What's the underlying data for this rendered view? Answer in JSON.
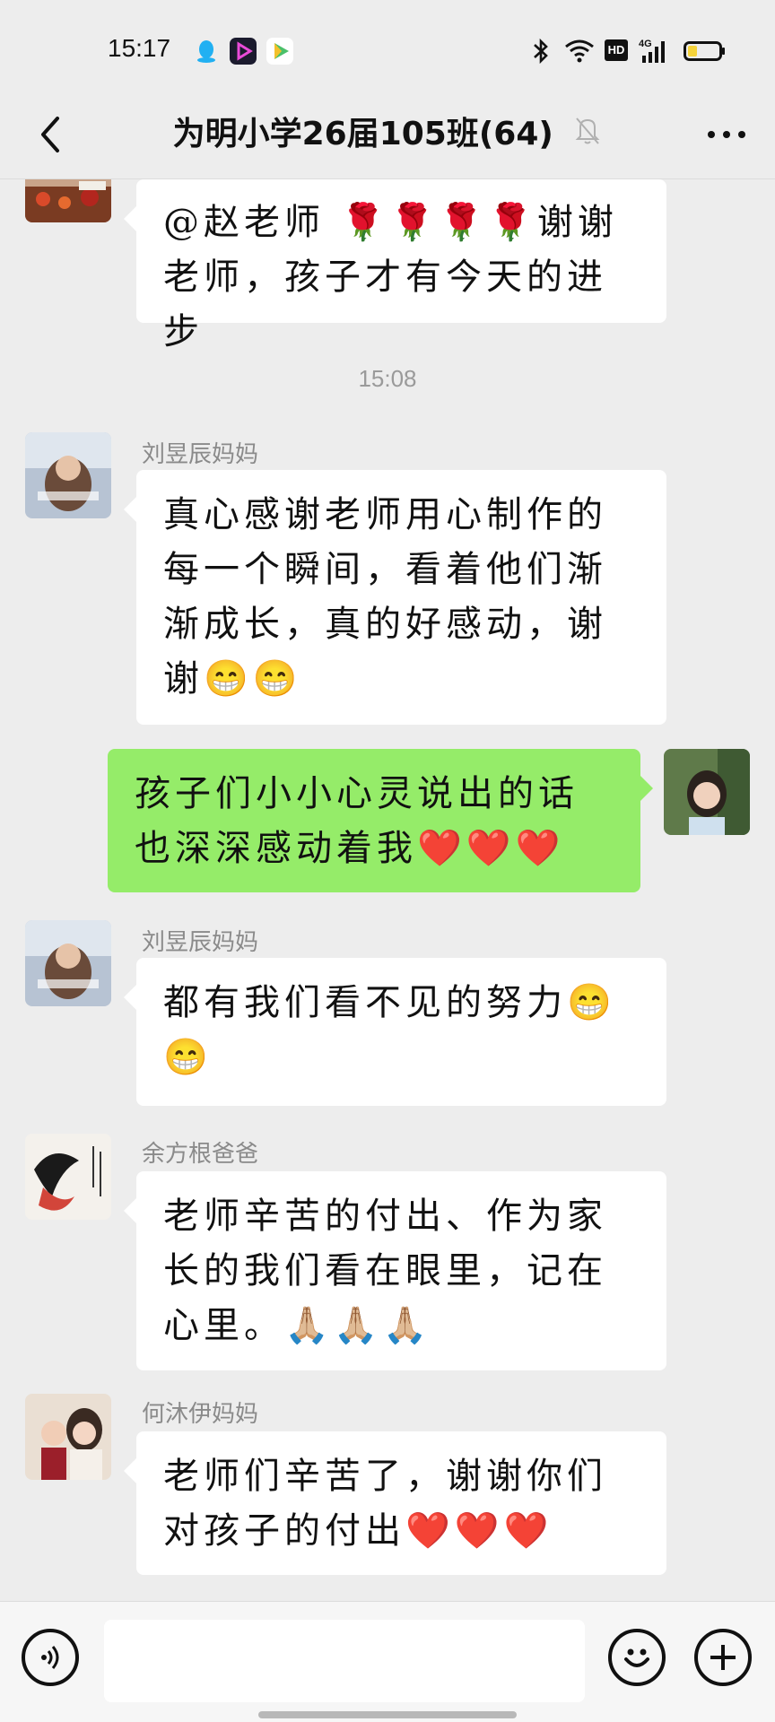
{
  "status_bar": {
    "time": "15:17",
    "icons": [
      "qq-icon",
      "video-app-icon",
      "media-play-icon"
    ],
    "right_icons": [
      "bluetooth-icon",
      "wifi-icon",
      "hd-icon",
      "4g-signal-icon",
      "battery-icon"
    ],
    "hd_label": "HD",
    "network_label": "4G"
  },
  "title_bar": {
    "title": "为明小学26届105班(64)",
    "muted": true
  },
  "messages": [
    {
      "type": "text",
      "side": "left",
      "sender": "",
      "avatar": "avatar-photo-food",
      "text": "@赵老师 🌹🌹🌹🌹谢谢老师，孩子才有今天的进步"
    },
    {
      "type": "time",
      "text": "15:08"
    },
    {
      "type": "text",
      "side": "left",
      "sender": "刘昱辰妈妈",
      "avatar": "avatar-photo-child",
      "text": "真心感谢老师用心制作的每一个瞬间，看着他们渐渐成长，真的好感动，谢谢😁😁"
    },
    {
      "type": "text",
      "side": "right",
      "sender": "",
      "avatar": "avatar-photo-self",
      "text": "孩子们小小心灵说出的话也深深感动着我❤️❤️❤️"
    },
    {
      "type": "text",
      "side": "left",
      "sender": "刘昱辰妈妈",
      "avatar": "avatar-photo-child",
      "text": "都有我们看不见的努力😁😁"
    },
    {
      "type": "text",
      "side": "left",
      "sender": "余方根爸爸",
      "avatar": "avatar-ink-painting",
      "text": "老师辛苦的付出、作为家长的我们看在眼里，记在心里。🙏🏼🙏🏼🙏🏼"
    },
    {
      "type": "text",
      "side": "left",
      "sender": "何沐伊妈妈",
      "avatar": "avatar-photo-family",
      "text": "老师们辛苦了，谢谢你们对孩子的付出❤️❤️❤️"
    }
  ],
  "input_bar": {
    "voice_icon": "voice-icon",
    "emoji_icon": "emoji-icon",
    "plus_icon": "plus-icon",
    "placeholder": ""
  },
  "colors": {
    "background": "#ededed",
    "bubble_self": "#95ec69",
    "bubble_other": "#ffffff"
  }
}
